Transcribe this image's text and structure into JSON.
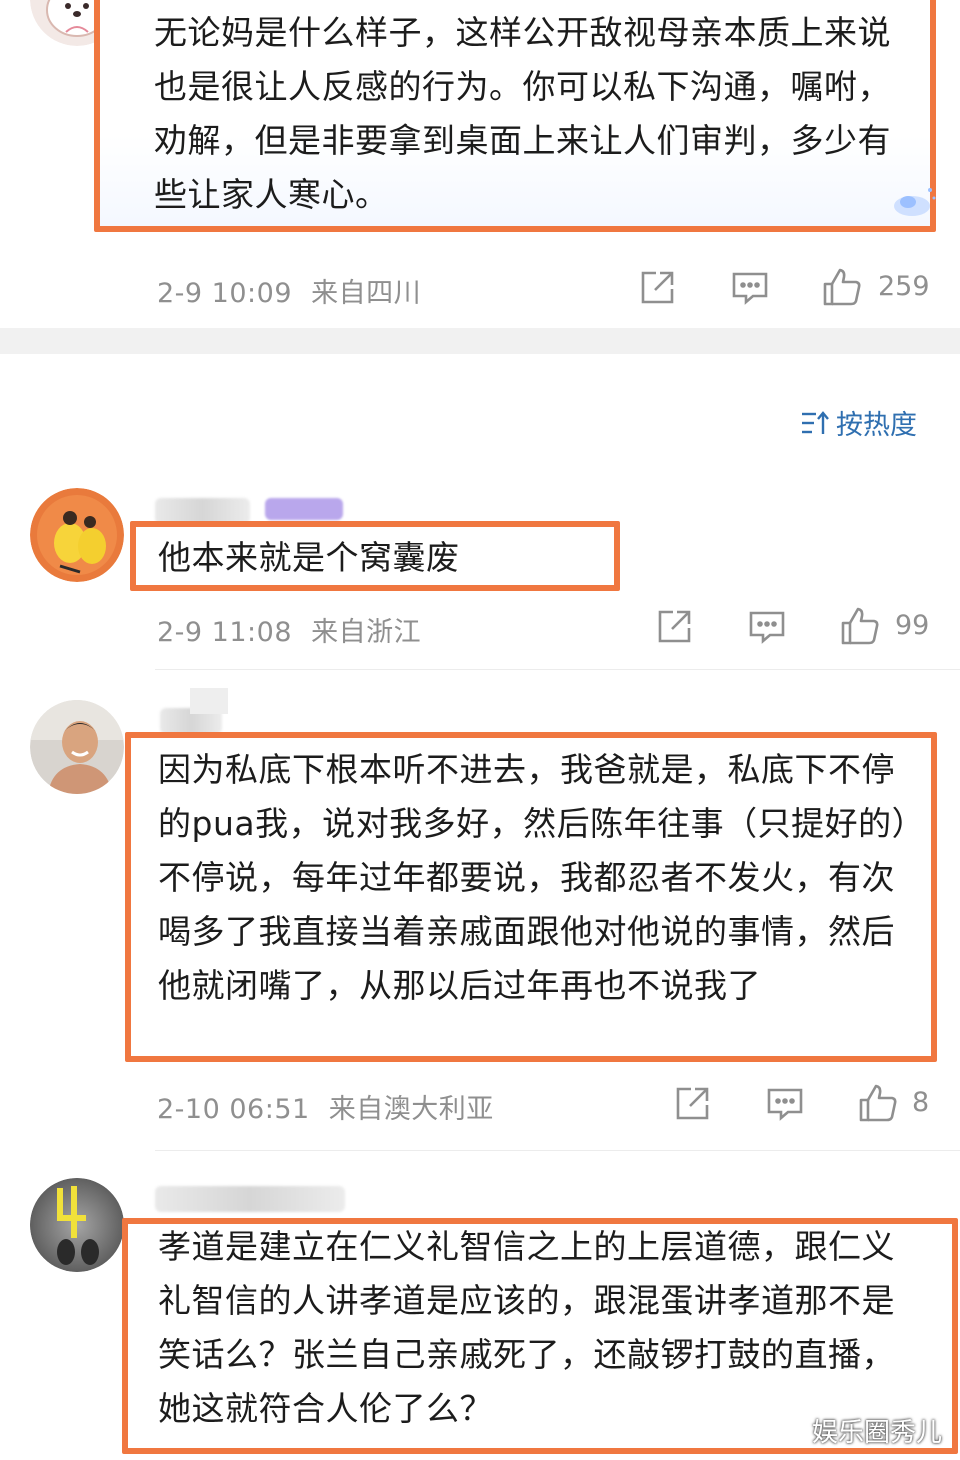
{
  "comments": [
    {
      "text": "无论妈是什么样子，这样公开敌视母亲本质上来说也是很让人反感的行为。你可以私下沟通，嘱咐，劝解，但是非要拿到桌面上来让人们审判，多少有些让家人寒心。",
      "time": "2-9 10:09",
      "location": "来自四川",
      "likes": "259"
    },
    {
      "text": "他本来就是个窝囊废",
      "time": "2-9 11:08",
      "location": "来自浙江",
      "likes": "99"
    },
    {
      "text": "因为私底下根本听不进去，我爸就是，私底下不停的pua我，说对我多好，然后陈年往事（只提好的）不停说，每年过年都要说，我都忍者不发火，有次喝多了我直接当着亲戚面跟他对他说的事情，然后他就闭嘴了，从那以后过年再也不说我了",
      "time": "2-10 06:51",
      "location": "来自澳大利亚",
      "likes": "8"
    },
    {
      "text": "孝道是建立在仁义礼智信之上的上层道德，跟仁义礼智信的人讲孝道是应该的，跟混蛋讲孝道那不是笑话么？张兰自己亲戚死了，还敲锣打鼓的直播，她这就符合人伦了么？"
    }
  ],
  "sort": {
    "label": "按热度",
    "icon": "sort-icon"
  },
  "watermark": "娱乐圈秀儿",
  "icons": {
    "share": "share-icon",
    "comment": "comment-icon",
    "like": "thumbs-up-icon"
  },
  "colors": {
    "highlight": "#f07740",
    "meta": "#8f8f8f",
    "sort": "#2f6fb0",
    "band": "#f1f1f1"
  }
}
